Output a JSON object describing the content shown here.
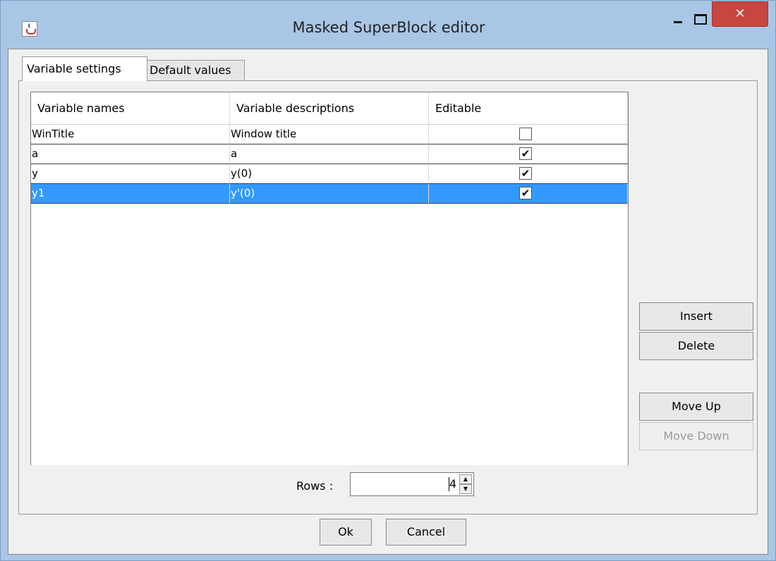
{
  "window": {
    "title": "Masked SuperBlock editor",
    "close_glyph": "✕"
  },
  "tabs": [
    {
      "label": "Variable settings",
      "active": true
    },
    {
      "label": "Default values",
      "active": false
    }
  ],
  "table": {
    "headers": [
      "Variable names",
      "Variable descriptions",
      "Editable"
    ],
    "rows": [
      {
        "name": "WinTitle",
        "description": "Window title",
        "editable": false,
        "selected": false
      },
      {
        "name": "a",
        "description": "a",
        "editable": true,
        "selected": false
      },
      {
        "name": "y",
        "description": "y(0)",
        "editable": true,
        "selected": false
      },
      {
        "name": "y1",
        "description": "y'(0)",
        "editable": true,
        "selected": true
      }
    ],
    "check_glyph": "✔"
  },
  "buttons": {
    "insert": "Insert",
    "delete": "Delete",
    "move_up": "Move Up",
    "move_down": "Move Down",
    "ok": "Ok",
    "cancel": "Cancel"
  },
  "rows_spinner": {
    "label": "Rows :",
    "value": "4"
  },
  "colors": {
    "selection": "#3399ff",
    "close_button": "#c7463f",
    "window_frame": "#a9c6e6"
  },
  "icons": [
    "java-app-icon",
    "minimize-icon",
    "maximize-icon",
    "close-icon",
    "checkbox-icon",
    "spinner-up-icon",
    "spinner-down-icon"
  ]
}
